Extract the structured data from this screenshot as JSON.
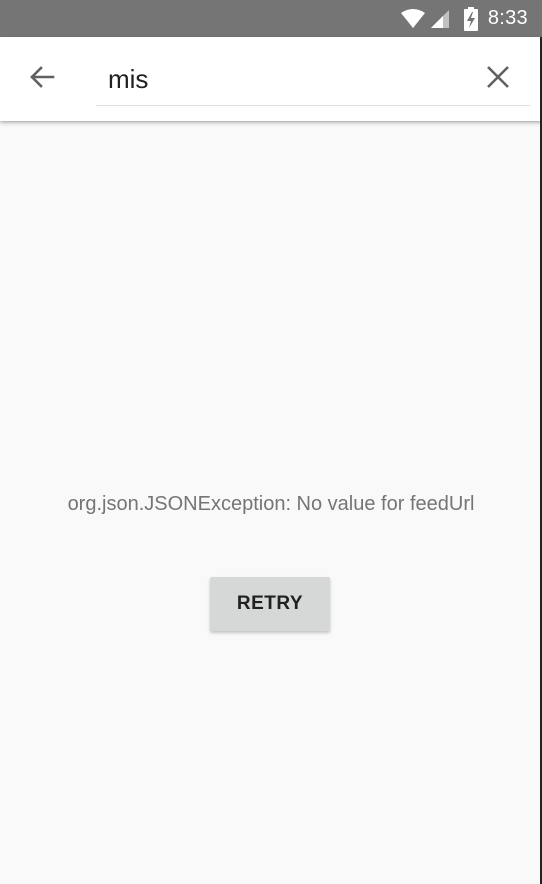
{
  "status_bar": {
    "time": "8:33",
    "icons": [
      "wifi-icon",
      "signal-icon",
      "battery-charging-icon"
    ],
    "background": "#757575"
  },
  "toolbar": {
    "back_icon": "arrow-back-icon",
    "search": {
      "value": "mis",
      "placeholder": ""
    },
    "clear_icon": "close-icon"
  },
  "main": {
    "error_message": "org.json.JSONException: No value for feedUrl",
    "retry_label": "RETRY"
  },
  "colors": {
    "background": "#f9f9f9",
    "toolbar": "#ffffff",
    "button": "#d6d7d7",
    "text_secondary": "#757575"
  }
}
